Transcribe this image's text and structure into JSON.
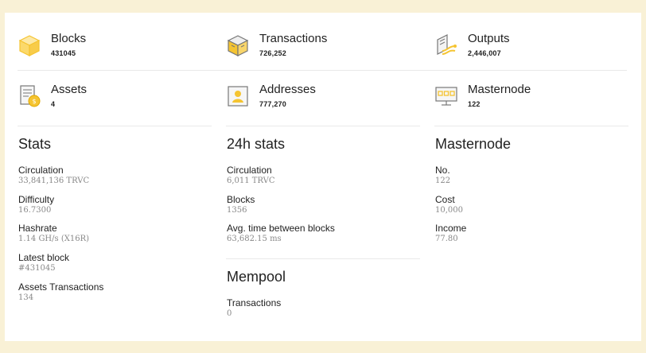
{
  "colors": {
    "background": "#f9f1d6",
    "card": "#ffffff",
    "accent": "#f5c431",
    "icon_gray": "#8a8a8a"
  },
  "summary": [
    {
      "icon": "blocks-cube-icon",
      "label": "Blocks",
      "value": "431045"
    },
    {
      "icon": "transactions-box-icon",
      "label": "Transactions",
      "value": "726,252"
    },
    {
      "icon": "outputs-icon",
      "label": "Outputs",
      "value": "2,446,007"
    },
    {
      "icon": "assets-document-icon",
      "label": "Assets",
      "value": "4"
    },
    {
      "icon": "addresses-id-card-icon",
      "label": "Addresses",
      "value": "777,270"
    },
    {
      "icon": "masternode-monitor-icon",
      "label": "Masternode",
      "value": "122"
    }
  ],
  "stats": {
    "title": "Stats",
    "items": [
      {
        "label": "Circulation",
        "value": "33,841,136 TRVC"
      },
      {
        "label": "Difficulty",
        "value": "16.7300"
      },
      {
        "label": "Hashrate",
        "value": "1.14 GH/s (X16R)"
      },
      {
        "label": "Latest block",
        "value": "#431045"
      },
      {
        "label": "Assets Transactions",
        "value": "134"
      }
    ]
  },
  "stats24h": {
    "title": "24h stats",
    "items": [
      {
        "label": "Circulation",
        "value": "6,011 TRVC"
      },
      {
        "label": "Blocks",
        "value": "1356"
      },
      {
        "label": "Avg. time between blocks",
        "value": "63,682.15 ms"
      }
    ]
  },
  "mempool": {
    "title": "Mempool",
    "items": [
      {
        "label": "Transactions",
        "value": "0"
      }
    ]
  },
  "masternode": {
    "title": "Masternode",
    "items": [
      {
        "label": "No.",
        "value": "122"
      },
      {
        "label": "Cost",
        "value": "10,000"
      },
      {
        "label": "Income",
        "value": "77.80"
      }
    ]
  }
}
